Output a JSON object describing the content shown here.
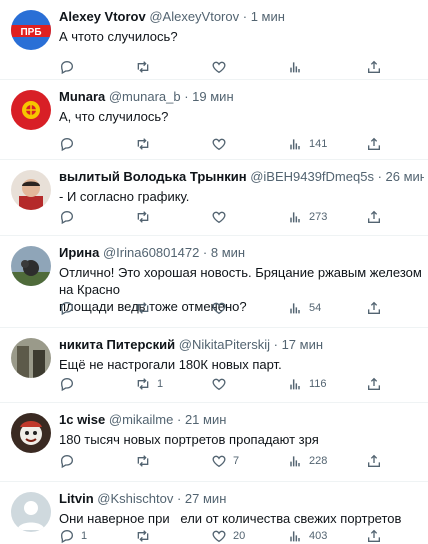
{
  "tweets": [
    {
      "name": "Alexey Vtorov",
      "handle": "@AlexeyVtorov",
      "time": "1 мин",
      "text": "А чтото случилось?",
      "replies": "",
      "retweets": "",
      "likes": "",
      "views": "",
      "avatar": "ПРБ",
      "avatar_color": "#2a6fd6"
    },
    {
      "name": "Munara",
      "handle": "@munara_b",
      "time": "19 мин",
      "text": "А, что случилось?",
      "replies": "",
      "retweets": "",
      "likes": "",
      "views": "141",
      "avatar": "",
      "avatar_color": "#d81f26"
    },
    {
      "name": "вылитый Володька Трынкин",
      "handle": "@iBEH9439fDmeq5s",
      "time": "26 мин",
      "text": "- И согласно графику.",
      "replies": "",
      "retweets": "",
      "likes": "",
      "views": "273",
      "avatar": "",
      "avatar_color": "#b52a2a"
    },
    {
      "name": "Ирина",
      "handle": "@Irina60801472",
      "time": "8 мин",
      "text": "Отлично! Это хорошая новость. Бряцание ржавым железом на Красно\nплощади ведь тоже отменено?",
      "replies": "",
      "retweets": "",
      "likes": "",
      "views": "54",
      "avatar": "",
      "avatar_color": "#4f6b3a"
    },
    {
      "name": "никита Питерский",
      "handle": "@NikitaPiterskij",
      "time": "17 мин",
      "text": "Ещё не настрогали 180К новых парт.",
      "replies": "",
      "retweets": "1",
      "likes": "",
      "views": "116",
      "avatar": "",
      "avatar_color": "#5d5a4a"
    },
    {
      "name": "1c wise",
      "handle": "@mikailme",
      "time": "21 мин",
      "text": "180 тысяч новых портретов пропадают зря",
      "replies": "",
      "retweets": "",
      "likes": "7",
      "views": "228",
      "avatar": "",
      "avatar_color": "#7a1f12"
    },
    {
      "name": "Litvin",
      "handle": "@Kshischtov",
      "time": "27 мин",
      "text": "Они наверное при   ели от количества свежих портретов",
      "replies": "1",
      "retweets": "",
      "likes": "20",
      "views": "403",
      "avatar": "",
      "avatar_color": "#cfd9de"
    }
  ]
}
